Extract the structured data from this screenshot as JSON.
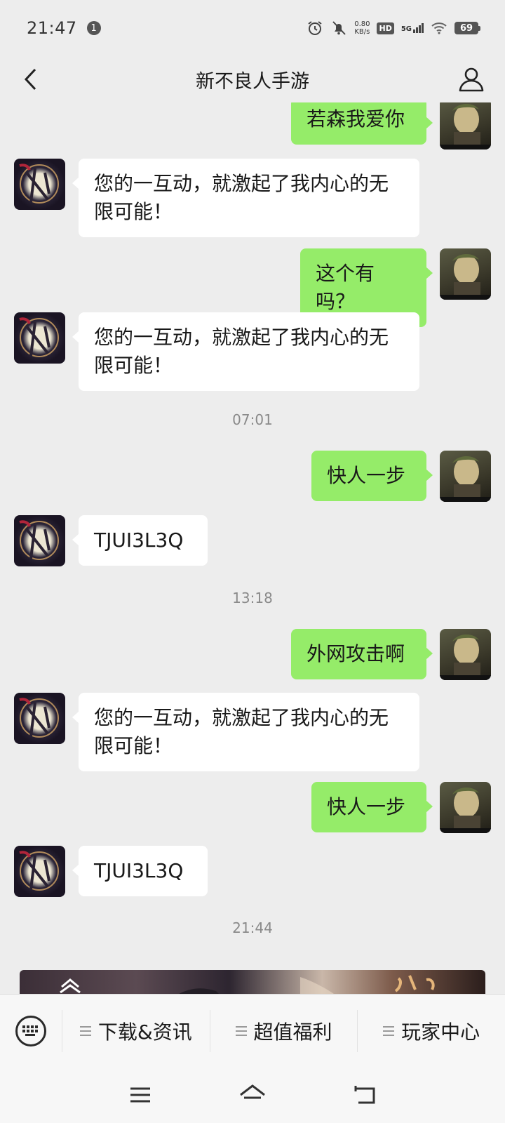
{
  "status_bar": {
    "time": "21:47",
    "notification_count": "1",
    "net_speed_value": "0.80",
    "net_speed_unit": "KB/s",
    "hd_label": "HD",
    "network_type": "5G",
    "battery_level": "69"
  },
  "nav": {
    "title": "新不良人手游",
    "back_icon": "chevron-left-icon",
    "profile_icon": "person-icon"
  },
  "messages": [
    {
      "side": "right",
      "text": "若森我爱你"
    },
    {
      "side": "left",
      "text": "您的一互动，就激起了我内心的无限可能！"
    },
    {
      "side": "right",
      "text": "这个有吗？"
    },
    {
      "side": "left",
      "text": "您的一互动，就激起了我内心的无限可能！"
    },
    {
      "side": "center",
      "text": "07:01"
    },
    {
      "side": "right",
      "text": "快人一步"
    },
    {
      "side": "left",
      "text": "TJUI3L3Q"
    },
    {
      "side": "center",
      "text": "13:18"
    },
    {
      "side": "right",
      "text": "外网攻击啊"
    },
    {
      "side": "left",
      "text": "您的一互动，就激起了我内心的无限可能！"
    },
    {
      "side": "right",
      "text": "快人一步"
    },
    {
      "side": "left",
      "text": "TJUI3L3Q"
    },
    {
      "side": "center",
      "text": "21:44"
    }
  ],
  "menu": {
    "keyboard_icon": "keyboard-icon",
    "items": [
      {
        "label": "下载&资讯"
      },
      {
        "label": "超值福利"
      },
      {
        "label": "玩家中心"
      }
    ]
  },
  "system_nav": {
    "icons": [
      "menu-icon",
      "home-icon",
      "back-icon"
    ]
  },
  "colors": {
    "background": "#ededed",
    "outgoing_bubble": "#95ec69",
    "incoming_bubble": "#ffffff"
  }
}
